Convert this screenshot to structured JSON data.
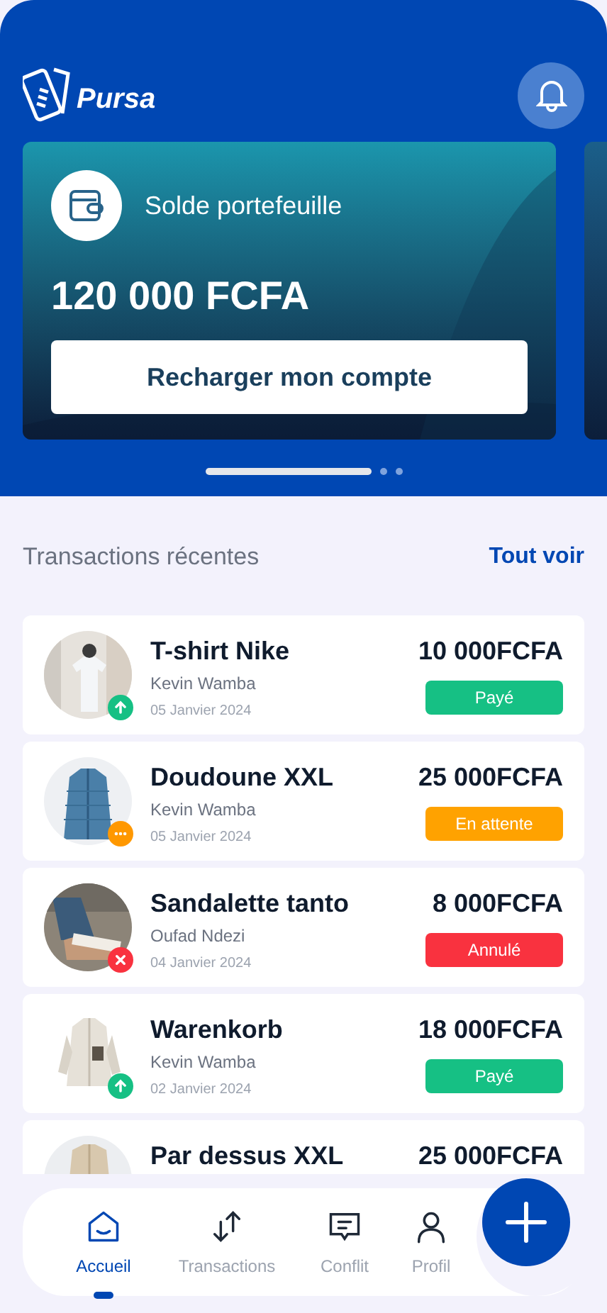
{
  "header": {
    "logo": "Pursa"
  },
  "balance_card": {
    "label": "Solde portefeuille",
    "amount": "120 000 FCFA",
    "button": "Recharger mon compte"
  },
  "carousel_dots": [
    {
      "selected": true
    },
    {
      "selected": false
    },
    {
      "selected": false
    }
  ],
  "section": {
    "title": "Transactions récentes",
    "link": "Tout voir"
  },
  "transactions": [
    {
      "title": "T-shirt Nike",
      "person": "Kevin Wamba",
      "date": "05 Janvier 2024",
      "amount": "10 000FCFA",
      "status": "Payé",
      "kind": "paid"
    },
    {
      "title": "Doudoune XXL",
      "person": "Kevin Wamba",
      "date": "05 Janvier 2024",
      "amount": "25 000FCFA",
      "status": "En attente",
      "kind": "pending"
    },
    {
      "title": "Sandalette tanto",
      "person": "Oufad Ndezi",
      "date": "04 Janvier 2024",
      "amount": "8 000FCFA",
      "status": "Annulé",
      "kind": "cancelled"
    },
    {
      "title": "Warenkorb",
      "person": "Kevin Wamba",
      "date": "02 Janvier 2024",
      "amount": "18 000FCFA",
      "status": "Payé",
      "kind": "paid"
    },
    {
      "title": "Par dessus XXL",
      "amount": "25 000FCFA",
      "kind": "hidden"
    }
  ],
  "nav": [
    {
      "label": "Accueil",
      "selected": true
    },
    {
      "label": "Transactions",
      "selected": false
    },
    {
      "label": "Conflit",
      "selected": false
    },
    {
      "label": "Profil",
      "selected": false
    }
  ]
}
